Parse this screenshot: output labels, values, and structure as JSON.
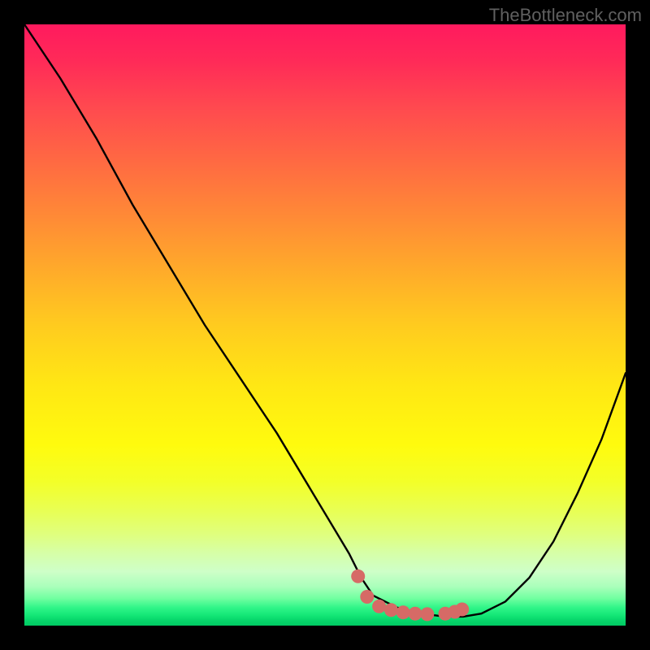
{
  "watermark": "TheBottleneck.com",
  "chart_data": {
    "type": "line",
    "title": "",
    "xlabel": "",
    "ylabel": "",
    "xlim": [
      0,
      100
    ],
    "ylim": [
      0,
      100
    ],
    "series": [
      {
        "name": "bottleneck-curve",
        "x": [
          0,
          6,
          12,
          18,
          24,
          30,
          36,
          42,
          48,
          54,
          56,
          58,
          62,
          66,
          70,
          73,
          76,
          80,
          84,
          88,
          92,
          96,
          100
        ],
        "y": [
          100,
          91,
          81,
          70,
          60,
          50,
          41,
          32,
          22,
          12,
          8,
          5,
          3,
          2,
          1.5,
          1.5,
          2,
          4,
          8,
          14,
          22,
          31,
          42
        ]
      },
      {
        "name": "matched-zone-dots",
        "x": [
          55.5,
          57,
          59,
          61,
          63,
          65,
          67,
          70,
          71.6,
          72.8
        ],
        "y": [
          8.2,
          4.8,
          3.2,
          2.6,
          2.2,
          2.0,
          1.9,
          2.0,
          2.3,
          2.7
        ]
      }
    ],
    "colors": {
      "curve": "#000000",
      "dots": "#d66a66",
      "gradient_top": "#ff1a5e",
      "gradient_mid": "#ffe714",
      "gradient_bottom": "#00ca63"
    }
  }
}
